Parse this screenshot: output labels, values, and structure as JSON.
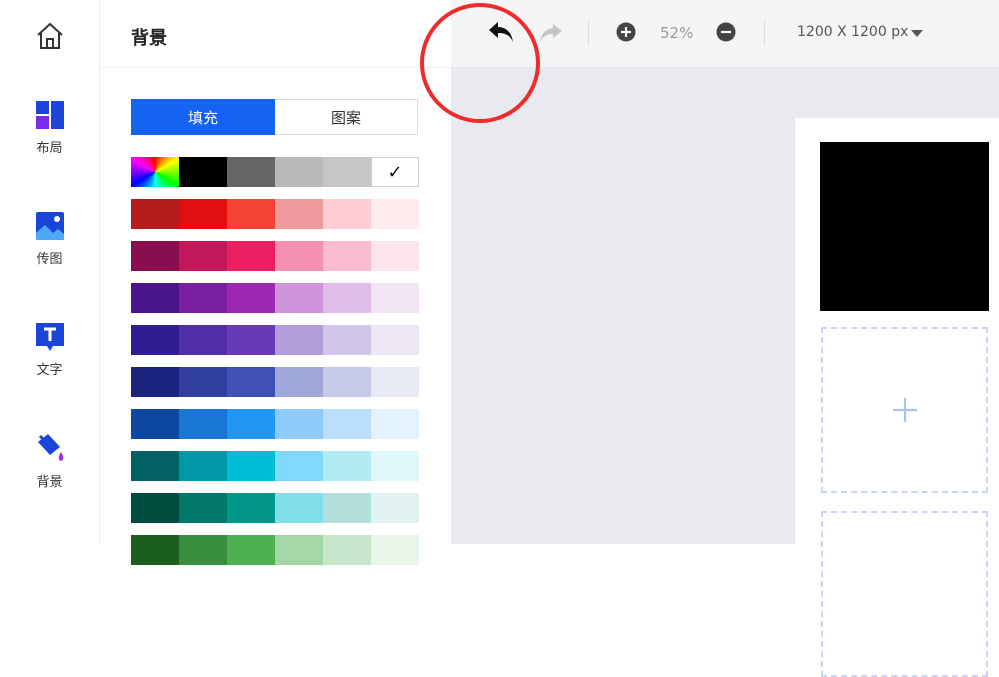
{
  "sidebar": {
    "items": [
      {
        "icon": "home-icon",
        "label": ""
      },
      {
        "icon": "layout-icon",
        "label": "布局"
      },
      {
        "icon": "image-icon",
        "label": "传图"
      },
      {
        "icon": "text-icon",
        "label": "文字"
      },
      {
        "icon": "paint-bucket-icon",
        "label": "背景"
      }
    ]
  },
  "panel": {
    "title": "背景",
    "tabs": [
      {
        "label": "填充",
        "active": true
      },
      {
        "label": "图案",
        "active": false
      }
    ],
    "check_mark": "✓",
    "palette": [
      [
        "rainbow",
        "#000000",
        "#666666",
        "#b9b9b9",
        "#c6c6c6",
        "#ffffff"
      ],
      [
        "#b71c1c",
        "#e01010",
        "#f44336",
        "#ef9a9a",
        "#ffcdd2",
        "#ffebee"
      ],
      [
        "#880e4f",
        "#c2185b",
        "#e91e63",
        "#f48fb1",
        "#f8bbd0",
        "#fce4ec"
      ],
      [
        "#4a148c",
        "#7b1fa2",
        "#9c27b0",
        "#ce93d8",
        "#e1bee7",
        "#f3e5f5"
      ],
      [
        "#311b92",
        "#512da8",
        "#673ab7",
        "#b39ddb",
        "#d1c4e9",
        "#ede7f6"
      ],
      [
        "#1a237e",
        "#303f9f",
        "#3f51b5",
        "#9fa8da",
        "#c5cae9",
        "#e8eaf6"
      ],
      [
        "#0d47a1",
        "#1976d2",
        "#2196f3",
        "#90caf9",
        "#bbdefb",
        "#e3f2fd"
      ],
      [
        "#006064",
        "#0097a7",
        "#00bcd4",
        "#80d8fa",
        "#b2ebf2",
        "#e0f7fa"
      ],
      [
        "#004d40",
        "#00796b",
        "#009688",
        "#80deea",
        "#b2dfdb",
        "#e0f2f1"
      ],
      [
        "#1b5e20",
        "#388e3c",
        "#4caf50",
        "#a5d6a7",
        "#c8e6c9",
        "#e8f5e9"
      ]
    ]
  },
  "toolbar": {
    "zoom": "52%",
    "canvas_size": "1200 X 1200 px"
  },
  "colors": {
    "accent": "#1463f3",
    "highlight": "#ee2c2c",
    "rail_icon": "#1a45d8"
  }
}
